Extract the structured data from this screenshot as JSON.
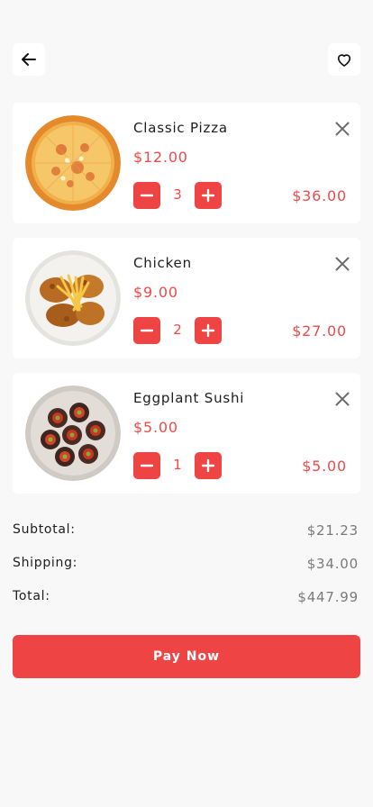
{
  "header": {
    "back_icon": "arrow-left-icon",
    "favorite_icon": "heart-icon"
  },
  "cart": {
    "items": [
      {
        "name": "Classic Pizza",
        "price": "$12.00",
        "quantity": "3",
        "line_total": "$36.00",
        "image": "pizza"
      },
      {
        "name": "Chicken",
        "price": "$9.00",
        "quantity": "2",
        "line_total": "$27.00",
        "image": "fried-chicken"
      },
      {
        "name": "Eggplant Sushi",
        "price": "$5.00",
        "quantity": "1",
        "line_total": "$5.00",
        "image": "eggplant-sushi"
      }
    ]
  },
  "summary": {
    "subtotal_label": "Subtotal:",
    "subtotal_value": "$21.23",
    "shipping_label": "Shipping:",
    "shipping_value": "$34.00",
    "total_label": "Total:",
    "total_value": "$447.99"
  },
  "checkout": {
    "pay_label": "Pay Now"
  },
  "colors": {
    "accent": "#ef4444",
    "price_text": "#ef4a4a",
    "muted_text": "#7a7a7a",
    "background": "#f8f8f8",
    "card": "#ffffff"
  }
}
